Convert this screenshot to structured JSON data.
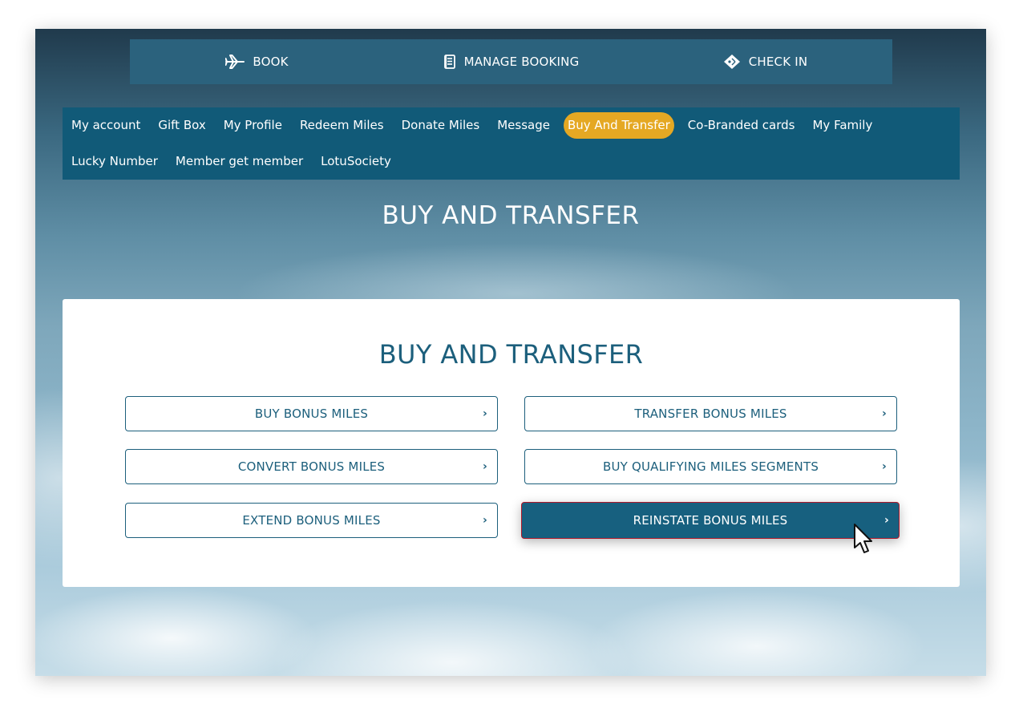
{
  "topbar": {
    "items": [
      {
        "label": "BOOK",
        "icon": "airplane-icon"
      },
      {
        "label": "MANAGE BOOKING",
        "icon": "document-icon"
      },
      {
        "label": "CHECK IN",
        "icon": "ticket-icon"
      }
    ]
  },
  "subnav": {
    "row1": [
      "My account",
      "Gift Box",
      "My Profile",
      "Redeem Miles",
      "Donate Miles",
      "Message",
      "Buy And Transfer",
      "Co-Branded cards",
      "My Family"
    ],
    "row2": [
      "Lucky Number",
      "Member get member",
      "LotuSociety"
    ],
    "active": "Buy And Transfer"
  },
  "page": {
    "title": "BUY AND TRANSFER"
  },
  "card": {
    "title": "BUY AND TRANSFER",
    "options": [
      {
        "label": "BUY BONUS MILES",
        "chevron": "›"
      },
      {
        "label": "TRANSFER BONUS MILES",
        "chevron": "›"
      },
      {
        "label": "CONVERT BONUS MILES",
        "chevron": "›"
      },
      {
        "label": "BUY QUALIFYING MILES SEGMENTS",
        "chevron": "›"
      },
      {
        "label": "EXTEND BONUS MILES",
        "chevron": "›"
      },
      {
        "label": "REINSTATE BONUS MILES",
        "chevron": "›"
      }
    ],
    "active_option": "REINSTATE BONUS MILES"
  },
  "colors": {
    "topbar": "#2b627d",
    "subnav": "#115a78",
    "active_tab": "#e5a823",
    "primary": "#1c5f7c",
    "active_border": "#b0192a"
  }
}
